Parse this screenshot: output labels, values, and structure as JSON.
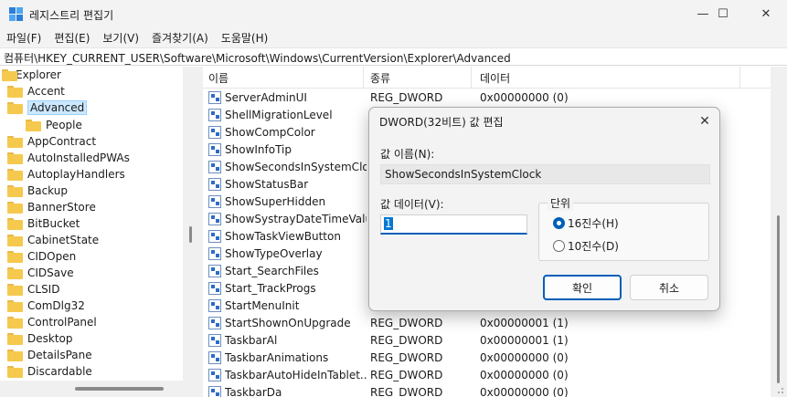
{
  "window": {
    "title": "레지스트리 편집기",
    "minimize": "—",
    "maximize": "☐",
    "close": "✕"
  },
  "menu": [
    "파일(F)",
    "편집(E)",
    "보기(V)",
    "즐겨찾기(A)",
    "도움말(H)"
  ],
  "address": "컴퓨터\\HKEY_CURRENT_USER\\Software\\Microsoft\\Windows\\CurrentVersion\\Explorer\\Advanced",
  "tree": {
    "root": "Explorer",
    "items": [
      "Accent",
      "Advanced",
      "People",
      "AppContract",
      "AutoInstalledPWAs",
      "AutoplayHandlers",
      "Backup",
      "BannerStore",
      "BitBucket",
      "CabinetState",
      "CIDOpen",
      "CIDSave",
      "CLSID",
      "ComDlg32",
      "ControlPanel",
      "Desktop",
      "DetailsPane",
      "Discardable"
    ],
    "selected": "Advanced"
  },
  "columns": {
    "name": "이름",
    "type": "종류",
    "data": "데이터"
  },
  "rows": [
    {
      "name": "ServerAdminUI",
      "type": "REG_DWORD",
      "data": "0x00000000 (0)"
    },
    {
      "name": "ShellMigrationLevel",
      "type": "",
      "data": ""
    },
    {
      "name": "ShowCompColor",
      "type": "",
      "data": ""
    },
    {
      "name": "ShowInfoTip",
      "type": "",
      "data": ""
    },
    {
      "name": "ShowSecondsInSystemClo...",
      "type": "",
      "data": ""
    },
    {
      "name": "ShowStatusBar",
      "type": "",
      "data": ""
    },
    {
      "name": "ShowSuperHidden",
      "type": "",
      "data": ""
    },
    {
      "name": "ShowSystrayDateTimeValu...",
      "type": "",
      "data": ""
    },
    {
      "name": "ShowTaskViewButton",
      "type": "",
      "data": ""
    },
    {
      "name": "ShowTypeOverlay",
      "type": "",
      "data": ""
    },
    {
      "name": "Start_SearchFiles",
      "type": "",
      "data": ""
    },
    {
      "name": "Start_TrackProgs",
      "type": "",
      "data": ""
    },
    {
      "name": "StartMenuInit",
      "type": "",
      "data": ""
    },
    {
      "name": "StartShownOnUpgrade",
      "type": "REG_DWORD",
      "data": "0x00000001 (1)"
    },
    {
      "name": "TaskbarAl",
      "type": "REG_DWORD",
      "data": "0x00000001 (1)"
    },
    {
      "name": "TaskbarAnimations",
      "type": "REG_DWORD",
      "data": "0x00000000 (0)"
    },
    {
      "name": "TaskbarAutoHideInTablet...",
      "type": "REG_DWORD",
      "data": "0x00000000 (0)"
    },
    {
      "name": "TaskbarDa",
      "type": "REG_DWORD",
      "data": "0x00000000 (0)"
    }
  ],
  "dialog": {
    "title": "DWORD(32비트) 값 편집",
    "close": "✕",
    "name_label": "값 이름(N):",
    "name_value": "ShowSecondsInSystemClock",
    "data_label": "값 데이터(V):",
    "data_value": "1",
    "radix_label": "단위",
    "radix_hex": "16진수(H)",
    "radix_dec": "10진수(D)",
    "ok": "확인",
    "cancel": "취소"
  },
  "colors": {
    "accent": "#005fb8",
    "selection": "#cce8ff",
    "folder": "#f5c94e"
  }
}
